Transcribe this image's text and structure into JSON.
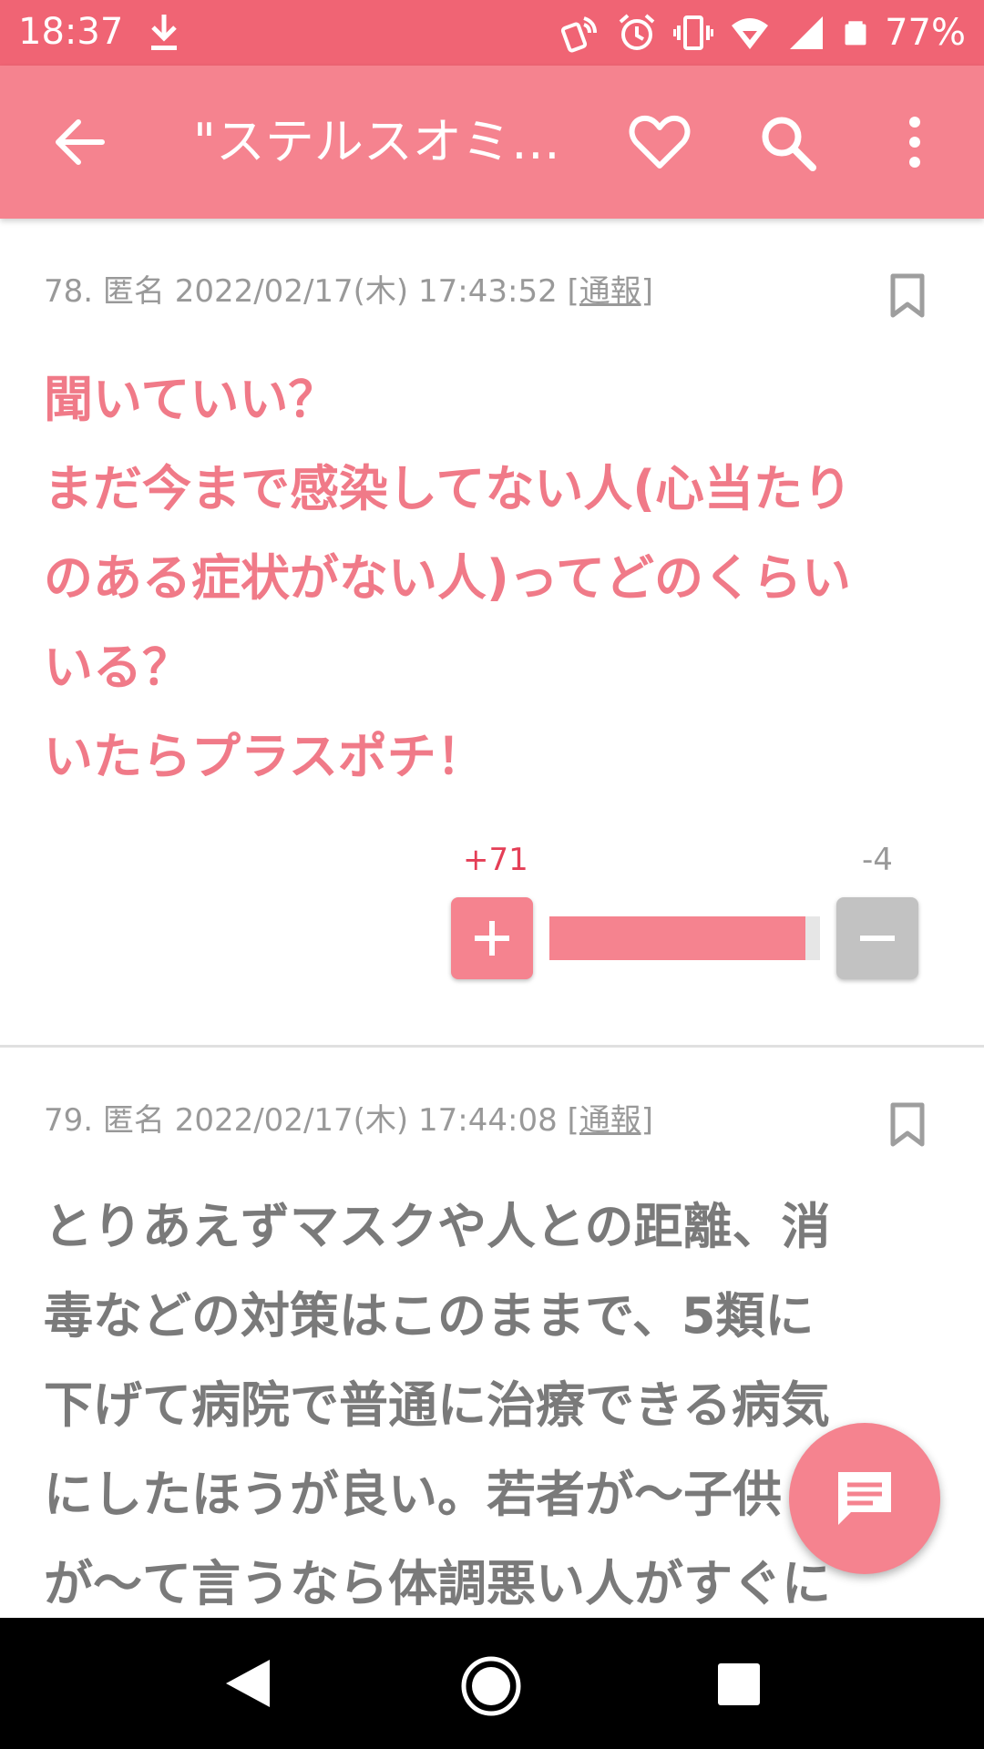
{
  "status_bar": {
    "time": "18:37",
    "battery": "77%"
  },
  "app_bar": {
    "title": "\"ステルスオミクロン\""
  },
  "colors": {
    "accent": "#f5838f",
    "status": "#f06474",
    "highlight_text": "#f07a88",
    "normal_text": "#7a7a7a",
    "plus_count": "#e43e56"
  },
  "posts": [
    {
      "number": "78.",
      "author": "匿名",
      "date": "2022/02/17(木) 17:43:52",
      "report": "[通報]",
      "lines": [
        "聞いていい？",
        "まだ今まで感染してない人(心当たり",
        "のある症状がない人)ってどのくらい",
        "いる？",
        "いたらプラスポチ！"
      ],
      "plus": "+71",
      "minus": "-4",
      "plus_ratio": 0.947
    },
    {
      "number": "79.",
      "author": "匿名",
      "date": "2022/02/17(木) 17:44:08",
      "report": "[通報]",
      "lines": [
        "とりあえずマスクや人との距離、消",
        "毒などの対策はこのままで、5類に",
        "下げて病院で普通に治療できる病気",
        "にしたほうが良い。若者が〜子供",
        "が〜て言うなら体調悪い人がすぐに"
      ]
    }
  ]
}
